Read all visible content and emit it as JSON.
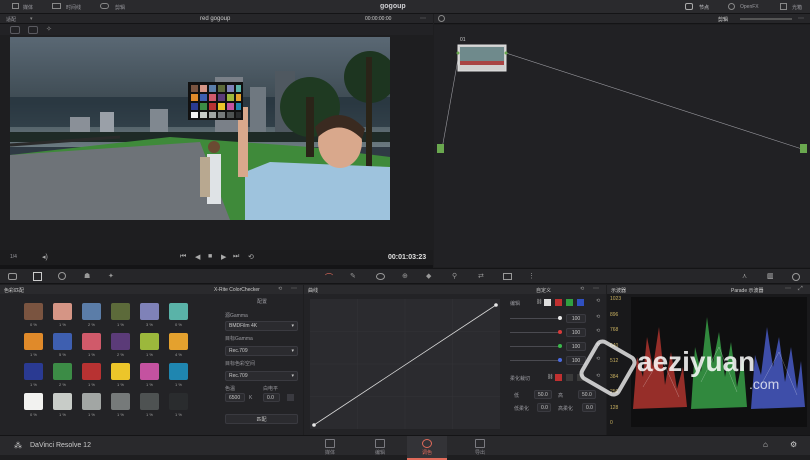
{
  "topbar": {
    "tab_media": "媒体",
    "tab_timeline": "时间线",
    "tab_clips": "剪辑",
    "project_title": "gogoup",
    "nodes": "节点",
    "openfx": "OpenFX",
    "lightbox": "光箱"
  },
  "viewer": {
    "label": "适配",
    "clip_name": "red gogoup",
    "timecode_top": "00:00:00:00",
    "timecode": "00:01:03:23",
    "zoom": "1/4"
  },
  "nodes": {
    "mode": "剪辑",
    "node_label": "01"
  },
  "match_panel": {
    "title": "色彩匹配",
    "chart": "X-Rite ColorChecker",
    "settings_title": "配置",
    "source_gamma_label": "源Gamma",
    "source_gamma": "BMDFilm 4K",
    "target_gamma_label": "目标Gamma",
    "target_gamma": "Rec.709",
    "target_space_label": "目标色彩空间",
    "target_space": "Rec.709",
    "temp_label": "色温",
    "temp_value": "6500",
    "white_level_label": "白电平",
    "white_level": "0.0",
    "match_button": "匹配",
    "swatch_labels": [
      "0 %",
      "1 %",
      "2 %",
      "1 %",
      "3 %",
      "0 %",
      "1 %",
      "5 %",
      "1 %",
      "2 %",
      "1 %",
      "4 %",
      "1 %",
      "2 %",
      "1 %",
      "1 %",
      "1 %",
      "1 %",
      "0 %",
      "1 %",
      "1 %",
      "1 %",
      "1 %",
      "1 %"
    ],
    "swatch_colors": [
      "#7a5440",
      "#d59585",
      "#5b7da8",
      "#5c6a3a",
      "#7f82b8",
      "#5ab3a8",
      "#e08a2a",
      "#3e5fb0",
      "#d05a6a",
      "#5b3b78",
      "#9cb83c",
      "#e4a12e",
      "#2a3a92",
      "#3c8c46",
      "#b83232",
      "#ecc52a",
      "#c452a0",
      "#1f86b0",
      "#f2f2f0",
      "#c8ccc8",
      "#a2a6a4",
      "#767a7a",
      "#4e5252",
      "#2a2c2e"
    ]
  },
  "curves": {
    "title": "曲线",
    "mode": "自定义",
    "edit_label": "编辑",
    "channel_values": [
      "100",
      "100",
      "100",
      "100"
    ],
    "soft_clip_label": "柔化裁切",
    "low_label": "低",
    "low_value": "50.0",
    "high_label": "高",
    "high_value": "50.0",
    "low_soft_label": "低柔化",
    "low_soft_value": "0.0",
    "high_soft_label": "高柔化",
    "high_soft_value": "0.0"
  },
  "scope": {
    "title": "示波器",
    "mode": "Parade 示波器",
    "ticks": [
      "1023",
      "896",
      "768",
      "640",
      "512",
      "384",
      "256",
      "128",
      "0"
    ]
  },
  "bottom": {
    "app_name": "DaVinci Resolve 12",
    "tab_media": "媒体",
    "tab_edit": "编辑",
    "tab_color": "调色",
    "tab_deliver": "导出"
  },
  "watermark": {
    "site": "aeziyuan",
    "domain": ".com"
  }
}
